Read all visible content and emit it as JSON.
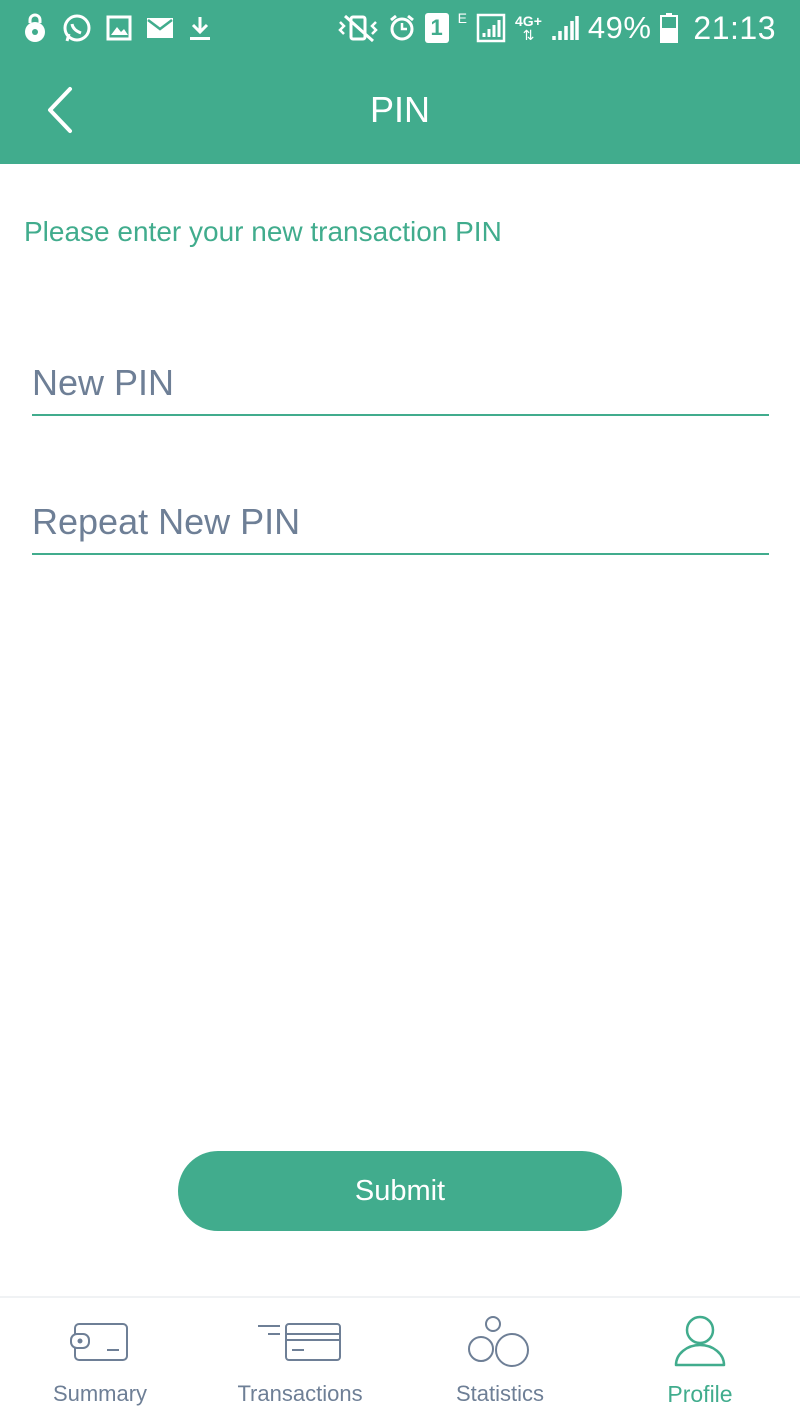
{
  "status_bar": {
    "battery_percent": "49%",
    "time": "21:13",
    "sim_badge": "1",
    "network_e": "E",
    "network_4g": "4G+",
    "left_icons": [
      "lock-icon",
      "whatsapp-icon",
      "gallery-icon",
      "mail-icon",
      "download-icon"
    ],
    "right_icons": [
      "vibrate-icon",
      "alarm-icon",
      "sim-icon",
      "signal-icon",
      "signal-4g-icon",
      "battery-icon"
    ]
  },
  "header": {
    "title": "PIN",
    "back_icon": "chevron-left-icon"
  },
  "main": {
    "instruction": "Please enter your new transaction PIN",
    "new_pin_placeholder": "New PIN",
    "new_pin_value": "",
    "repeat_pin_placeholder": "Repeat New PIN",
    "repeat_pin_value": "",
    "submit_label": "Submit"
  },
  "nav": {
    "items": [
      {
        "label": "Summary",
        "icon": "wallet-icon",
        "active": false
      },
      {
        "label": "Transactions",
        "icon": "card-icon",
        "active": false
      },
      {
        "label": "Statistics",
        "icon": "circles-icon",
        "active": false
      },
      {
        "label": "Profile",
        "icon": "user-icon",
        "active": true
      }
    ]
  },
  "colors": {
    "brand": "#41ac8d",
    "muted": "#6e7f96",
    "background": "#ffffff"
  }
}
